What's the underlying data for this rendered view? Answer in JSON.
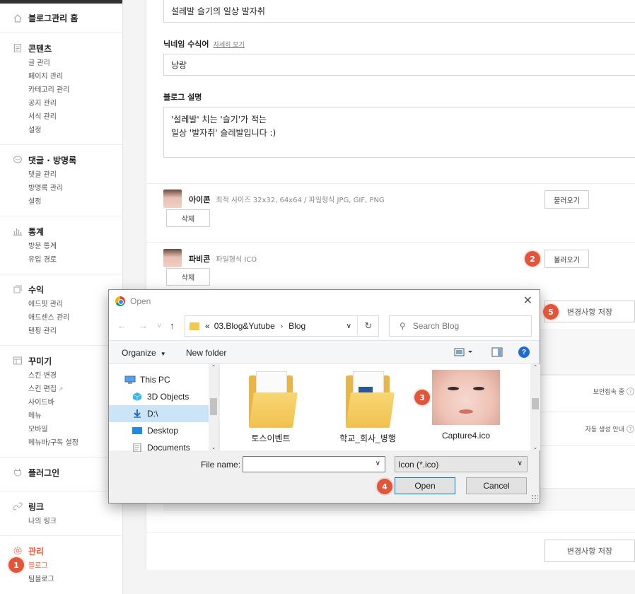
{
  "sidebar": {
    "home": "블로그관리 홈",
    "sections": [
      {
        "title": "콘텐츠",
        "items": [
          "글 관리",
          "페이지 관리",
          "카테고리 관리",
          "공지 관리",
          "서식 관리",
          "설정"
        ]
      },
      {
        "title": "댓글 · 방명록",
        "items": [
          "댓글 관리",
          "방명록 관리",
          "설정"
        ]
      },
      {
        "title": "통계",
        "items": [
          "방문 통계",
          "유입 경로"
        ]
      },
      {
        "title": "수익",
        "items": [
          "애드핏 관리",
          "애드센스 관리",
          "텐핑 관리"
        ]
      },
      {
        "title": "꾸미기",
        "items": [
          "스킨 변경",
          "스킨 편집",
          "사이드바",
          "메뉴",
          "모바일",
          "메뉴바/구독 설정"
        ]
      },
      {
        "title": "플러그인",
        "items": []
      },
      {
        "title": "링크",
        "items": [
          "나의 링크"
        ]
      },
      {
        "title": "관리",
        "items": [
          "블로그",
          "팀블로그"
        ]
      }
    ]
  },
  "form": {
    "blog_name_value": "설레발 슬기의 일상 발자취",
    "nickname_label": "닉네임 수식어",
    "nickname_help": "자세히 보기",
    "nickname_value": "낭랑",
    "desc_label": "블로그 설명",
    "desc_line1": "'설레발' 치는 '슬기'가 적는",
    "desc_line2": "일상 '발자취' 슬레발입니다 :)",
    "icon_label": "아이콘",
    "icon_hint": "최적 사이즈 32x32, 64x64 / 파일형식 JPG, GIF, PNG",
    "favicon_label": "파비콘",
    "favicon_hint": "파일형식 ICO",
    "load_button": "불러오기",
    "delete_button": "삭제",
    "save_button": "변경사항 저장",
    "secure_text": "보안접속 중",
    "auto_text": "자동 생성 안내",
    "help_glyph": "?"
  },
  "markers": [
    "1",
    "2",
    "3",
    "4",
    "5"
  ],
  "dialog": {
    "title": "Open",
    "close": "✕",
    "path_prefix": "«",
    "path": [
      "03.Blog&Yutube",
      "Blog"
    ],
    "search_placeholder": "Search Blog",
    "organize": "Organize",
    "new_folder": "New folder",
    "help": "?",
    "tree": [
      "This PC",
      "3D Objects",
      "D:\\",
      "Desktop",
      "Documents"
    ],
    "files": [
      "토스이벤트",
      "학교_회사_병행",
      "Capture4.ico"
    ],
    "file_name_label": "File name:",
    "file_name_value": "",
    "file_type": "Icon (*.ico)",
    "open_button": "Open",
    "cancel_button": "Cancel"
  },
  "colors": {
    "accent": "#f25b3b",
    "marker": "#e1553a",
    "selection": "#cce4f7"
  }
}
